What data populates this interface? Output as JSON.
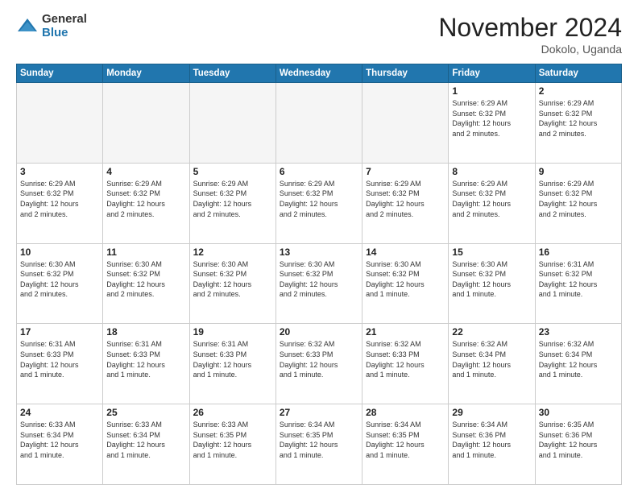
{
  "logo": {
    "general": "General",
    "blue": "Blue"
  },
  "title": {
    "month": "November 2024",
    "location": "Dokolo, Uganda"
  },
  "weekdays": [
    "Sunday",
    "Monday",
    "Tuesday",
    "Wednesday",
    "Thursday",
    "Friday",
    "Saturday"
  ],
  "weeks": [
    [
      {
        "day": "",
        "info": ""
      },
      {
        "day": "",
        "info": ""
      },
      {
        "day": "",
        "info": ""
      },
      {
        "day": "",
        "info": ""
      },
      {
        "day": "",
        "info": ""
      },
      {
        "day": "1",
        "info": "Sunrise: 6:29 AM\nSunset: 6:32 PM\nDaylight: 12 hours\nand 2 minutes."
      },
      {
        "day": "2",
        "info": "Sunrise: 6:29 AM\nSunset: 6:32 PM\nDaylight: 12 hours\nand 2 minutes."
      }
    ],
    [
      {
        "day": "3",
        "info": "Sunrise: 6:29 AM\nSunset: 6:32 PM\nDaylight: 12 hours\nand 2 minutes."
      },
      {
        "day": "4",
        "info": "Sunrise: 6:29 AM\nSunset: 6:32 PM\nDaylight: 12 hours\nand 2 minutes."
      },
      {
        "day": "5",
        "info": "Sunrise: 6:29 AM\nSunset: 6:32 PM\nDaylight: 12 hours\nand 2 minutes."
      },
      {
        "day": "6",
        "info": "Sunrise: 6:29 AM\nSunset: 6:32 PM\nDaylight: 12 hours\nand 2 minutes."
      },
      {
        "day": "7",
        "info": "Sunrise: 6:29 AM\nSunset: 6:32 PM\nDaylight: 12 hours\nand 2 minutes."
      },
      {
        "day": "8",
        "info": "Sunrise: 6:29 AM\nSunset: 6:32 PM\nDaylight: 12 hours\nand 2 minutes."
      },
      {
        "day": "9",
        "info": "Sunrise: 6:29 AM\nSunset: 6:32 PM\nDaylight: 12 hours\nand 2 minutes."
      }
    ],
    [
      {
        "day": "10",
        "info": "Sunrise: 6:30 AM\nSunset: 6:32 PM\nDaylight: 12 hours\nand 2 minutes."
      },
      {
        "day": "11",
        "info": "Sunrise: 6:30 AM\nSunset: 6:32 PM\nDaylight: 12 hours\nand 2 minutes."
      },
      {
        "day": "12",
        "info": "Sunrise: 6:30 AM\nSunset: 6:32 PM\nDaylight: 12 hours\nand 2 minutes."
      },
      {
        "day": "13",
        "info": "Sunrise: 6:30 AM\nSunset: 6:32 PM\nDaylight: 12 hours\nand 2 minutes."
      },
      {
        "day": "14",
        "info": "Sunrise: 6:30 AM\nSunset: 6:32 PM\nDaylight: 12 hours\nand 1 minute."
      },
      {
        "day": "15",
        "info": "Sunrise: 6:30 AM\nSunset: 6:32 PM\nDaylight: 12 hours\nand 1 minute."
      },
      {
        "day": "16",
        "info": "Sunrise: 6:31 AM\nSunset: 6:32 PM\nDaylight: 12 hours\nand 1 minute."
      }
    ],
    [
      {
        "day": "17",
        "info": "Sunrise: 6:31 AM\nSunset: 6:33 PM\nDaylight: 12 hours\nand 1 minute."
      },
      {
        "day": "18",
        "info": "Sunrise: 6:31 AM\nSunset: 6:33 PM\nDaylight: 12 hours\nand 1 minute."
      },
      {
        "day": "19",
        "info": "Sunrise: 6:31 AM\nSunset: 6:33 PM\nDaylight: 12 hours\nand 1 minute."
      },
      {
        "day": "20",
        "info": "Sunrise: 6:32 AM\nSunset: 6:33 PM\nDaylight: 12 hours\nand 1 minute."
      },
      {
        "day": "21",
        "info": "Sunrise: 6:32 AM\nSunset: 6:33 PM\nDaylight: 12 hours\nand 1 minute."
      },
      {
        "day": "22",
        "info": "Sunrise: 6:32 AM\nSunset: 6:34 PM\nDaylight: 12 hours\nand 1 minute."
      },
      {
        "day": "23",
        "info": "Sunrise: 6:32 AM\nSunset: 6:34 PM\nDaylight: 12 hours\nand 1 minute."
      }
    ],
    [
      {
        "day": "24",
        "info": "Sunrise: 6:33 AM\nSunset: 6:34 PM\nDaylight: 12 hours\nand 1 minute."
      },
      {
        "day": "25",
        "info": "Sunrise: 6:33 AM\nSunset: 6:34 PM\nDaylight: 12 hours\nand 1 minute."
      },
      {
        "day": "26",
        "info": "Sunrise: 6:33 AM\nSunset: 6:35 PM\nDaylight: 12 hours\nand 1 minute."
      },
      {
        "day": "27",
        "info": "Sunrise: 6:34 AM\nSunset: 6:35 PM\nDaylight: 12 hours\nand 1 minute."
      },
      {
        "day": "28",
        "info": "Sunrise: 6:34 AM\nSunset: 6:35 PM\nDaylight: 12 hours\nand 1 minute."
      },
      {
        "day": "29",
        "info": "Sunrise: 6:34 AM\nSunset: 6:36 PM\nDaylight: 12 hours\nand 1 minute."
      },
      {
        "day": "30",
        "info": "Sunrise: 6:35 AM\nSunset: 6:36 PM\nDaylight: 12 hours\nand 1 minute."
      }
    ]
  ]
}
